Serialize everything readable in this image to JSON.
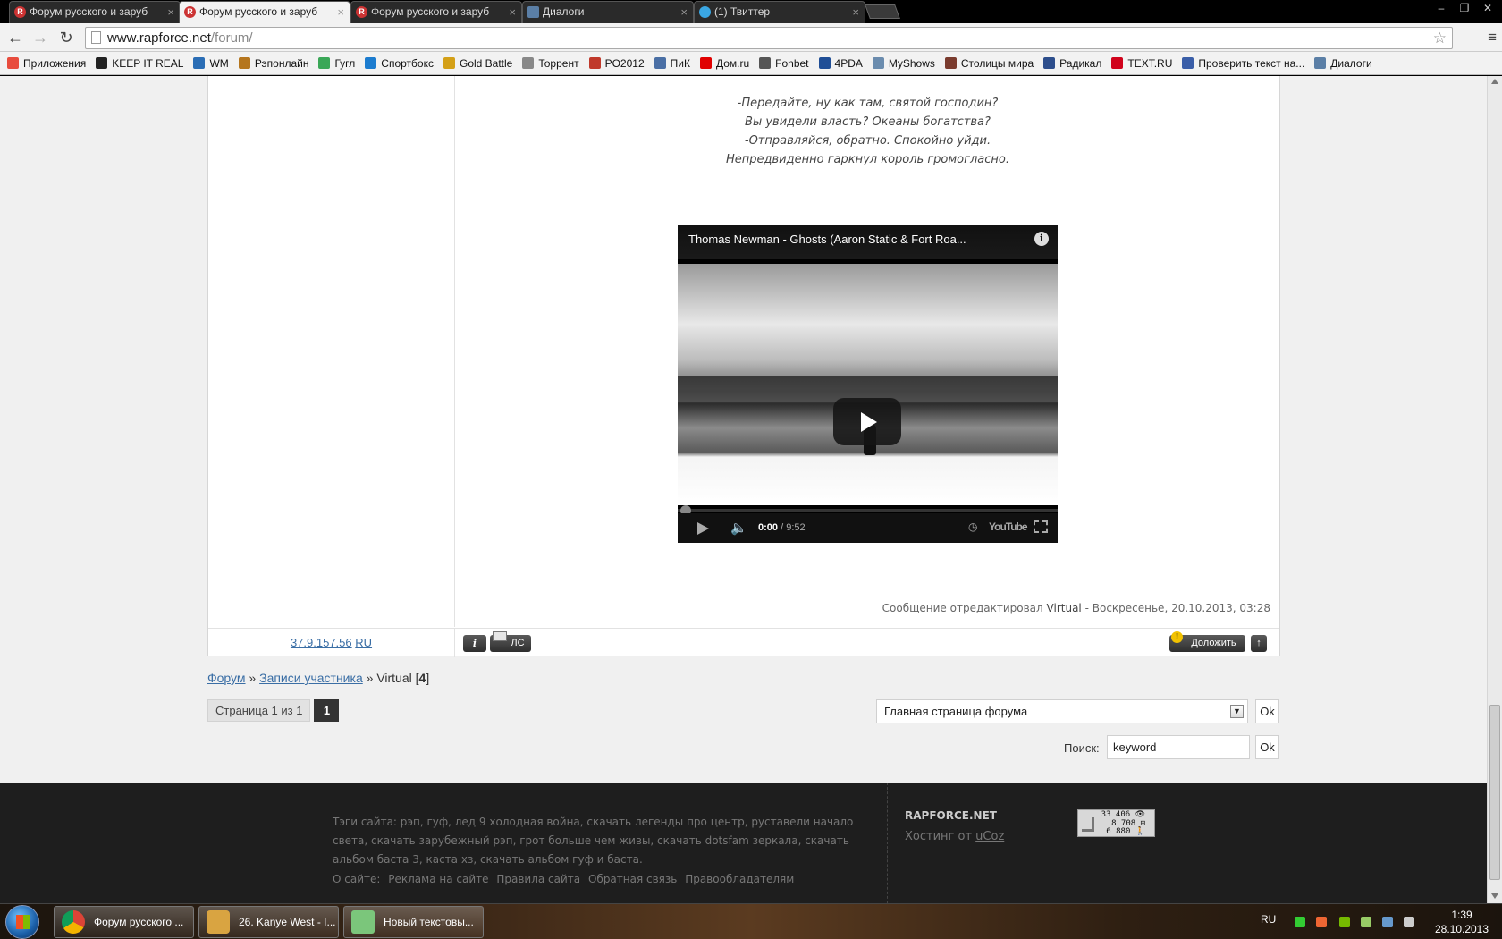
{
  "browser": {
    "tabs": [
      {
        "title": "Форум русского и заруб",
        "icon": "rapforce-icon",
        "active": false
      },
      {
        "title": "Форум русского и заруб",
        "icon": "rapforce-icon",
        "active": true
      },
      {
        "title": "Форум русского и заруб",
        "icon": "rapforce-icon",
        "active": false
      },
      {
        "title": "Диалоги",
        "icon": "vk-icon",
        "active": false
      },
      {
        "title": "(1) Твиттер",
        "icon": "twitter-icon",
        "active": false
      }
    ],
    "url_host": "www.rapforce.net",
    "url_path": "/forum/",
    "bookmarks": [
      {
        "label": "Приложения",
        "color": "#e84c3d"
      },
      {
        "label": "KEEP IT REAL",
        "color": "#222222"
      },
      {
        "label": "WM",
        "color": "#2a6db5"
      },
      {
        "label": "Рэпонлайн",
        "color": "#b5761e"
      },
      {
        "label": "Гугл",
        "color": "#3aa757"
      },
      {
        "label": "Спортбокс",
        "color": "#1c7ccf"
      },
      {
        "label": "Gold Battle",
        "color": "#d4a017"
      },
      {
        "label": "Торрент",
        "color": "#888888"
      },
      {
        "label": "PO2012",
        "color": "#c0392b"
      },
      {
        "label": "ПиК",
        "color": "#4a6fa5"
      },
      {
        "label": "Дом.ru",
        "color": "#e00000"
      },
      {
        "label": "Fonbet",
        "color": "#555555"
      },
      {
        "label": "4PDA",
        "color": "#1f4e96"
      },
      {
        "label": "MyShows",
        "color": "#6b8cae"
      },
      {
        "label": "Столицы мира",
        "color": "#7a3b2e"
      },
      {
        "label": "Радикал",
        "color": "#2d4e8c"
      },
      {
        "label": "TEXT.RU",
        "color": "#d0021b"
      },
      {
        "label": "Проверить текст на...",
        "color": "#3a5ea8"
      },
      {
        "label": "Диалоги",
        "color": "#5b7fa6"
      }
    ]
  },
  "post": {
    "poem": [
      "-Передайте, ну как там, святой господин?",
      "Вы увидели власть? Океаны богатства?",
      "-Отправляйся, обратно. Спокойно уйди.",
      "Непредвиденно гаркнул король громогласно."
    ],
    "video": {
      "title": "Thomas Newman - Ghosts (Aaron Static & Fort Roa...",
      "current_time": "0:00",
      "duration": "/ 9:52",
      "brand": "YouTube",
      "info": "i"
    },
    "edit_note": {
      "prefix": "Сообщение отредактировал",
      "user": "Virtual",
      "suffix": "- Воскресенье, 20.10.2013, 03:28"
    },
    "ip": "37.9.157.56",
    "country": "RU",
    "btn_info": "i",
    "btn_pm": "ЛС",
    "btn_report": "Доложить",
    "btn_top": "↑"
  },
  "breadcrumbs": {
    "forum": "Форум",
    "sep1": "»",
    "posts": "Записи участника",
    "sep2": "»",
    "user": "Virtual",
    "count_open": "[",
    "count": "4",
    "count_close": "]"
  },
  "pager": {
    "label": "Страница 1 из 1",
    "current": "1"
  },
  "jump": {
    "selected": "Главная страница форума",
    "ok": "Ok"
  },
  "search": {
    "label": "Поиск:",
    "value": "keyword",
    "ok": "Ok"
  },
  "footer": {
    "tags": "Тэги сайта: рэп, гуф, лед 9 холодная война, скачать легенды про центр, руставели начало света, скачать зарубежный рэп, грот больше чем живы, скачать dotsfam зеркала, скачать альбом баста 3, каста хз, скачать альбом гуф и баста.",
    "about_label": "О сайте:",
    "about_links": [
      "Реклама на сайте",
      "Правила сайта",
      "Обратная связь",
      "Правообладателям"
    ],
    "brand": "RAPFORCE.NET",
    "host_prefix": "Хостинг от",
    "host_link": "uCoz",
    "counter": [
      "33 406 👁",
      "8 708 ⊞",
      "6 880 🚶"
    ]
  },
  "taskbar": {
    "items": [
      {
        "label": "Форум русского ...",
        "color": "#e9b52f"
      },
      {
        "label": "26. Kanye West - I...",
        "color": "#d9a441"
      },
      {
        "label": "Новый текстовы...",
        "color": "#7bc67b"
      }
    ],
    "lang": "RU",
    "time": "1:39",
    "date": "28.10.2013"
  }
}
